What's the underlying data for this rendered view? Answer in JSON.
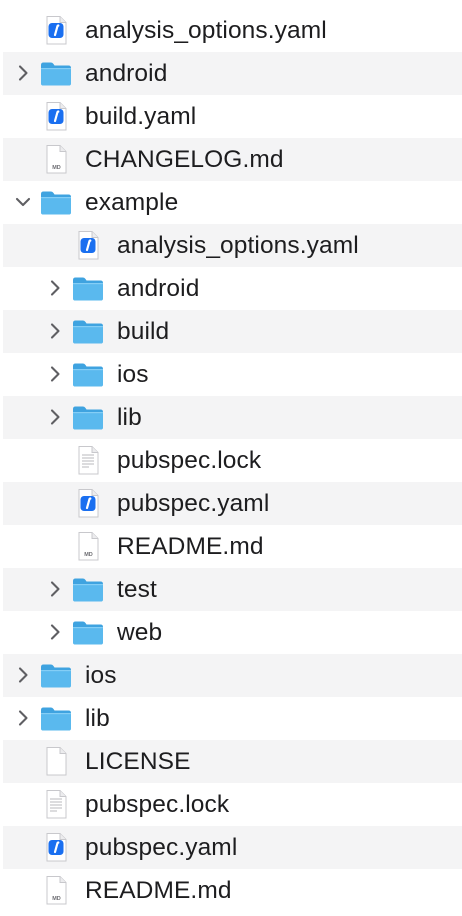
{
  "rows": [
    {
      "name": "analysis_options.yaml",
      "type": "yaml",
      "level": 0,
      "chevron": "none"
    },
    {
      "name": "android",
      "type": "folder",
      "level": 0,
      "chevron": "collapsed"
    },
    {
      "name": "build.yaml",
      "type": "yaml",
      "level": 0,
      "chevron": "none"
    },
    {
      "name": "CHANGELOG.md",
      "type": "md",
      "level": 0,
      "chevron": "none"
    },
    {
      "name": "example",
      "type": "folder",
      "level": 0,
      "chevron": "expanded"
    },
    {
      "name": "analysis_options.yaml",
      "type": "yaml",
      "level": 1,
      "chevron": "none"
    },
    {
      "name": "android",
      "type": "folder",
      "level": 1,
      "chevron": "collapsed"
    },
    {
      "name": "build",
      "type": "folder",
      "level": 1,
      "chevron": "collapsed"
    },
    {
      "name": "ios",
      "type": "folder",
      "level": 1,
      "chevron": "collapsed"
    },
    {
      "name": "lib",
      "type": "folder",
      "level": 1,
      "chevron": "collapsed"
    },
    {
      "name": "pubspec.lock",
      "type": "text",
      "level": 1,
      "chevron": "none"
    },
    {
      "name": "pubspec.yaml",
      "type": "yaml",
      "level": 1,
      "chevron": "none"
    },
    {
      "name": "README.md",
      "type": "md",
      "level": 1,
      "chevron": "none"
    },
    {
      "name": "test",
      "type": "folder",
      "level": 1,
      "chevron": "collapsed"
    },
    {
      "name": "web",
      "type": "folder",
      "level": 1,
      "chevron": "collapsed"
    },
    {
      "name": "ios",
      "type": "folder",
      "level": 0,
      "chevron": "collapsed"
    },
    {
      "name": "lib",
      "type": "folder",
      "level": 0,
      "chevron": "collapsed"
    },
    {
      "name": "LICENSE",
      "type": "blank",
      "level": 0,
      "chevron": "none"
    },
    {
      "name": "pubspec.lock",
      "type": "text",
      "level": 0,
      "chevron": "none"
    },
    {
      "name": "pubspec.yaml",
      "type": "yaml",
      "level": 0,
      "chevron": "none"
    },
    {
      "name": "README.md",
      "type": "md",
      "level": 0,
      "chevron": "none"
    }
  ],
  "icons": {
    "folder": "folder-icon",
    "yaml": "yaml-file-icon",
    "md": "markdown-file-icon",
    "text": "text-file-icon",
    "blank": "document-icon"
  },
  "icon_badges": {
    "md": "MD"
  },
  "colors": {
    "alt_row": "#f4f4f5",
    "folder_front": "#5ab9ee",
    "folder_back": "#3fa3e0",
    "yaml_badge": "#1a6ff0",
    "text": "#1d1d1f",
    "chevron": "#5f5f63"
  }
}
